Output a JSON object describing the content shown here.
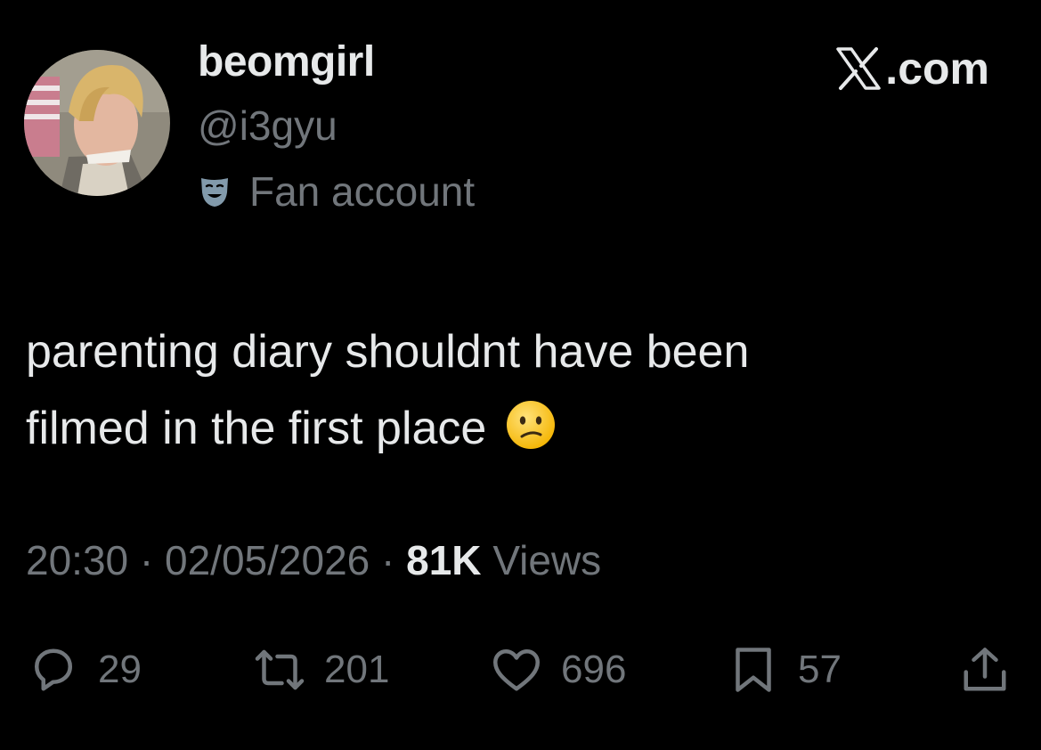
{
  "user": {
    "display_name": "beomgirl",
    "handle": "@i3gyu",
    "label": "Fan account",
    "label_icon": "theater-mask-icon",
    "avatar": "profile-photo"
  },
  "brand": {
    "text": ".com",
    "logo_icon": "x-logo-icon"
  },
  "tweet": {
    "lines": [
      "parenting diary shouldnt have been",
      "filmed in the first place"
    ],
    "emoji": "confused-face-emoji"
  },
  "meta": {
    "time": "20:30",
    "separator": "·",
    "date": "02/05/2026",
    "views_count": "81K",
    "views_label": "Views"
  },
  "actions": {
    "replies": "29",
    "reposts": "201",
    "likes": "696",
    "bookmarks": "57"
  },
  "colors": {
    "background": "#000000",
    "primary_text": "#e7e9ea",
    "secondary_text": "#71767b",
    "emoji_yellow": "#f7c543"
  }
}
